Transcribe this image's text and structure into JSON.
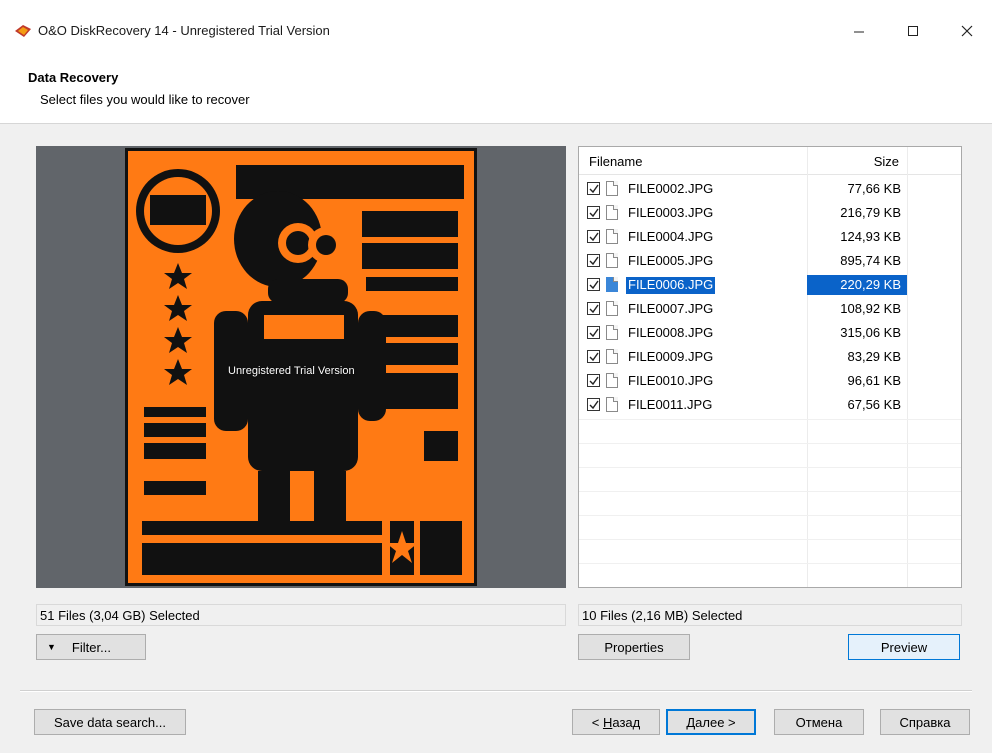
{
  "window": {
    "title": "O&O DiskRecovery 14 - Unregistered Trial Version",
    "icon": "oo-app-icon"
  },
  "header": {
    "title": "Data Recovery",
    "subtitle": "Select files you would like to recover"
  },
  "preview": {
    "watermark": "Unregistered Trial Version",
    "image": "robot-worker-poster"
  },
  "file_list": {
    "columns": {
      "filename": "Filename",
      "size": "Size"
    },
    "rows": [
      {
        "name": "FILE0002.JPG",
        "size": "77,66 KB",
        "checked": true,
        "selected": false
      },
      {
        "name": "FILE0003.JPG",
        "size": "216,79 KB",
        "checked": true,
        "selected": false
      },
      {
        "name": "FILE0004.JPG",
        "size": "124,93 KB",
        "checked": true,
        "selected": false
      },
      {
        "name": "FILE0005.JPG",
        "size": "895,74 KB",
        "checked": true,
        "selected": false
      },
      {
        "name": "FILE0006.JPG",
        "size": "220,29 KB",
        "checked": true,
        "selected": true
      },
      {
        "name": "FILE0007.JPG",
        "size": "108,92 KB",
        "checked": true,
        "selected": false
      },
      {
        "name": "FILE0008.JPG",
        "size": "315,06 KB",
        "checked": true,
        "selected": false
      },
      {
        "name": "FILE0009.JPG",
        "size": "83,29 KB",
        "checked": true,
        "selected": false
      },
      {
        "name": "FILE0010.JPG",
        "size": "96,61 KB",
        "checked": true,
        "selected": false
      },
      {
        "name": "FILE0011.JPG",
        "size": "67,56 KB",
        "checked": true,
        "selected": false
      }
    ]
  },
  "status": {
    "left": "51 Files (3,04 GB) Selected",
    "right": "10 Files (2,16 MB) Selected"
  },
  "buttons": {
    "filter": "Filter...",
    "properties": "Properties",
    "preview": "Preview",
    "save_search": "Save data search...",
    "back_u": "Н",
    "back_rest": "азад",
    "back_prefix": "< ",
    "next_u": "Д",
    "next_rest": "алее >",
    "cancel": "Отмена",
    "help": "Справка"
  },
  "colors": {
    "selection": "#0a63c9",
    "accent": "#0078d7",
    "poster_orange": "#ff7a14"
  }
}
